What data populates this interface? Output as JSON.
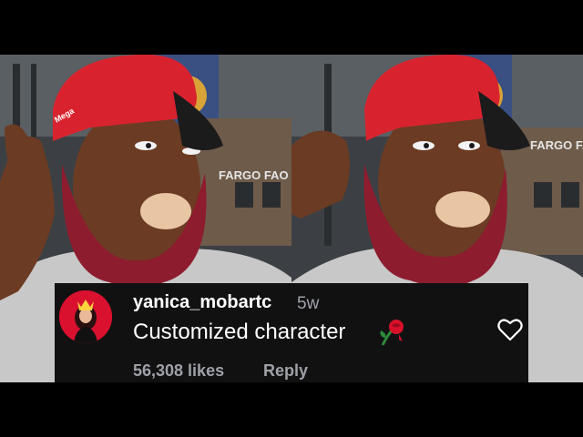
{
  "background_photos": {
    "storefront_sign_text": "FARGO FAO",
    "cap_logo_text": "Mega",
    "colors": {
      "cap": "#d8232f",
      "beard": "#8e1c2f",
      "skin": "#6b3b23",
      "shirt": "#c8c8c8",
      "mouthpiece": "#e8c6a4"
    }
  },
  "comment": {
    "username": "yanica_mobartc",
    "age": "5w",
    "text": "Customized character",
    "emoji_icon": "rose-icon",
    "likes": "56,308 likes",
    "reply_label": "Reply",
    "heart_icon": "heart-outline-icon",
    "colors": {
      "background": "#111112",
      "primary_text": "#ffffff",
      "secondary_text": "#9ea1a7",
      "avatar_bg": "#d9112e"
    }
  }
}
